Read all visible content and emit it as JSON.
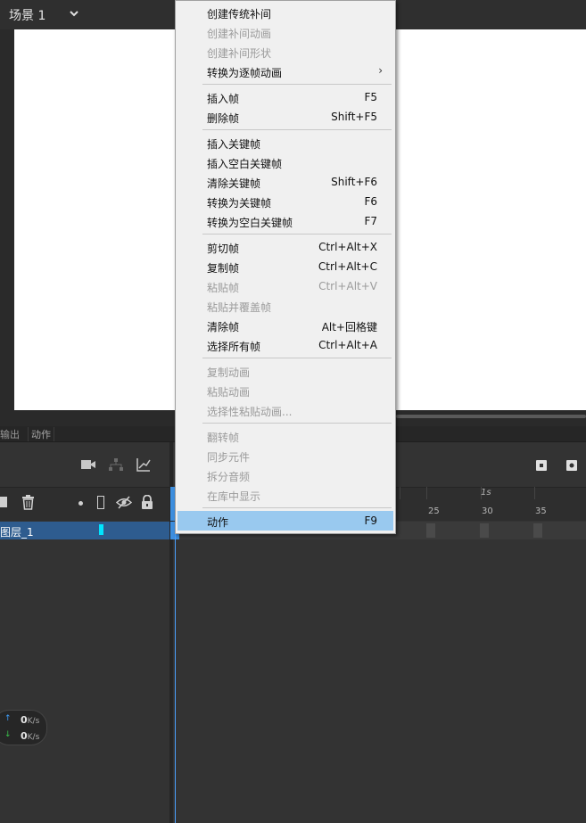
{
  "scene": {
    "label": "场景 1"
  },
  "panel_tabs": {
    "output": "输出",
    "action": "动作"
  },
  "timeline": {
    "layer_name": "图层_1",
    "ruler": {
      "second_label": "1s",
      "numbers": [
        "25",
        "30",
        "35"
      ]
    }
  },
  "speed": {
    "up": {
      "value": "0",
      "unit": "K/s"
    },
    "down": {
      "value": "0",
      "unit": "K/s"
    }
  },
  "context_menu": {
    "items": [
      {
        "label": "创建传统补间",
        "shortcut": "",
        "disabled": false
      },
      {
        "label": "创建补间动画",
        "shortcut": "",
        "disabled": true
      },
      {
        "label": "创建补间形状",
        "shortcut": "",
        "disabled": true
      },
      {
        "label": "转换为逐帧动画",
        "shortcut": "",
        "disabled": false,
        "submenu": true
      },
      {
        "label": "插入帧",
        "shortcut": "F5",
        "disabled": false
      },
      {
        "label": "删除帧",
        "shortcut": "Shift+F5",
        "disabled": false
      },
      {
        "label": "插入关键帧",
        "shortcut": "",
        "disabled": false
      },
      {
        "label": "插入空白关键帧",
        "shortcut": "",
        "disabled": false
      },
      {
        "label": "清除关键帧",
        "shortcut": "Shift+F6",
        "disabled": false
      },
      {
        "label": "转换为关键帧",
        "shortcut": "F6",
        "disabled": false
      },
      {
        "label": "转换为空白关键帧",
        "shortcut": "F7",
        "disabled": false
      },
      {
        "label": "剪切帧",
        "shortcut": "Ctrl+Alt+X",
        "disabled": false
      },
      {
        "label": "复制帧",
        "shortcut": "Ctrl+Alt+C",
        "disabled": false
      },
      {
        "label": "粘贴帧",
        "shortcut": "Ctrl+Alt+V",
        "disabled": true
      },
      {
        "label": "粘贴并覆盖帧",
        "shortcut": "",
        "disabled": true
      },
      {
        "label": "清除帧",
        "shortcut": "Alt+回格键",
        "disabled": false
      },
      {
        "label": "选择所有帧",
        "shortcut": "Ctrl+Alt+A",
        "disabled": false
      },
      {
        "label": "复制动画",
        "shortcut": "",
        "disabled": true
      },
      {
        "label": "粘贴动画",
        "shortcut": "",
        "disabled": true
      },
      {
        "label": "选择性粘贴动画...",
        "shortcut": "",
        "disabled": true
      },
      {
        "label": "翻转帧",
        "shortcut": "",
        "disabled": true
      },
      {
        "label": "同步元件",
        "shortcut": "",
        "disabled": true
      },
      {
        "label": "拆分音频",
        "shortcut": "",
        "disabled": true
      },
      {
        "label": "在库中显示",
        "shortcut": "",
        "disabled": true
      },
      {
        "label": "动作",
        "shortcut": "F9",
        "disabled": false,
        "highlighted": true
      }
    ],
    "submenu_arrow": "›"
  }
}
